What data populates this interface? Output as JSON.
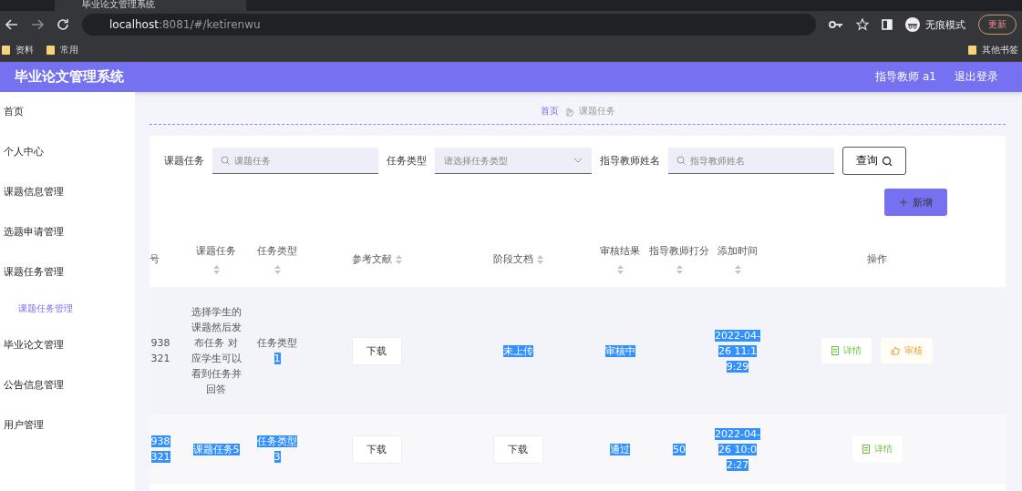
{
  "browser": {
    "tab_title": "毕业论文管理系统",
    "url_host": "localhost",
    "url_rest": ":8081/#/ketirenwu",
    "profile": "无痕模式",
    "update_button": "更新",
    "bookmarks": [
      "资料",
      "常用"
    ],
    "other_bookmarks": "其他书签"
  },
  "header": {
    "title": "毕业论文管理系统",
    "user": "指导教师 a1",
    "logout": "退出登录"
  },
  "sidebar": {
    "items": [
      {
        "label": "首页",
        "selected": false
      },
      {
        "label": "个人中心",
        "selected": false
      },
      {
        "label": "课题信息管理",
        "selected": false
      },
      {
        "label": "选题申请管理",
        "selected": false
      },
      {
        "label": "课题任务管理",
        "selected": false,
        "children": [
          {
            "label": "课题任务管理",
            "selected": true
          }
        ]
      },
      {
        "label": "毕业论文管理",
        "selected": false
      },
      {
        "label": "公告信息管理",
        "selected": false
      },
      {
        "label": "用户管理",
        "selected": false
      }
    ]
  },
  "breadcrumb": {
    "home": "首页",
    "current": "课题任务"
  },
  "search": {
    "fields": [
      {
        "label": "课题任务",
        "kind": "text",
        "placeholder": "课题任务"
      },
      {
        "label": "任务类型",
        "kind": "select",
        "placeholder": "请选择任务类型"
      },
      {
        "label": "指导教师姓名",
        "kind": "text",
        "placeholder": "指导教师姓名"
      }
    ],
    "query_button": "查询",
    "add_button": "新增"
  },
  "table": {
    "columns": [
      {
        "label": "号",
        "sortable": false
      },
      {
        "label": "课题任务",
        "sortable": true
      },
      {
        "label": "任务类型",
        "sortable": true
      },
      {
        "label": "参考文献",
        "sortable": true
      },
      {
        "label": "阶段文档",
        "sortable": true
      },
      {
        "label": "审核结果",
        "sortable": true
      },
      {
        "label": "指导教师打分",
        "sortable": true
      },
      {
        "label": "添加时间",
        "sortable": true
      },
      {
        "label": "操作",
        "sortable": false
      }
    ],
    "rows": [
      {
        "cells": [
          {
            "kind": "text",
            "parts": [
              {
                "text": "938321",
                "highlighted": false
              }
            ]
          },
          {
            "kind": "text",
            "parts": [
              {
                "text": "选择学生的课题然后发布任务 对应学生可以看到任务并回答",
                "highlighted": false
              }
            ]
          },
          {
            "kind": "text",
            "parts": [
              {
                "text": "任务类型",
                "highlighted": false
              },
              {
                "text": "1",
                "highlighted": true
              }
            ]
          },
          {
            "kind": "button",
            "label": "下载"
          },
          {
            "kind": "text",
            "parts": [
              {
                "text": "未上传",
                "highlighted": true
              }
            ]
          },
          {
            "kind": "text",
            "parts": [
              {
                "text": "审核中",
                "highlighted": true
              }
            ]
          },
          {
            "kind": "empty"
          },
          {
            "kind": "text",
            "parts": [
              {
                "text": "2022-04-26 11:19:29",
                "highlighted": true
              }
            ]
          }
        ],
        "actions": [
          {
            "kind": "detail",
            "label": "详情"
          },
          {
            "kind": "review",
            "label": "审核"
          }
        ]
      },
      {
        "cells": [
          {
            "kind": "text",
            "parts": [
              {
                "text": "938321",
                "highlighted": true
              }
            ]
          },
          {
            "kind": "text",
            "parts": [
              {
                "text": "课题任务5",
                "highlighted": true
              }
            ]
          },
          {
            "kind": "text",
            "parts": [
              {
                "text": "任务类型3",
                "highlighted": true
              }
            ]
          },
          {
            "kind": "button",
            "label": "下载"
          },
          {
            "kind": "button",
            "label": "下载"
          },
          {
            "kind": "text",
            "parts": [
              {
                "text": "通过",
                "highlighted": true
              }
            ]
          },
          {
            "kind": "text",
            "parts": [
              {
                "text": "50",
                "highlighted": true
              }
            ]
          },
          {
            "kind": "text",
            "parts": [
              {
                "text": "2022-04-26 10:02:27",
                "highlighted": true
              }
            ]
          }
        ],
        "actions": [
          {
            "kind": "detail",
            "label": "详情"
          }
        ]
      }
    ]
  }
}
